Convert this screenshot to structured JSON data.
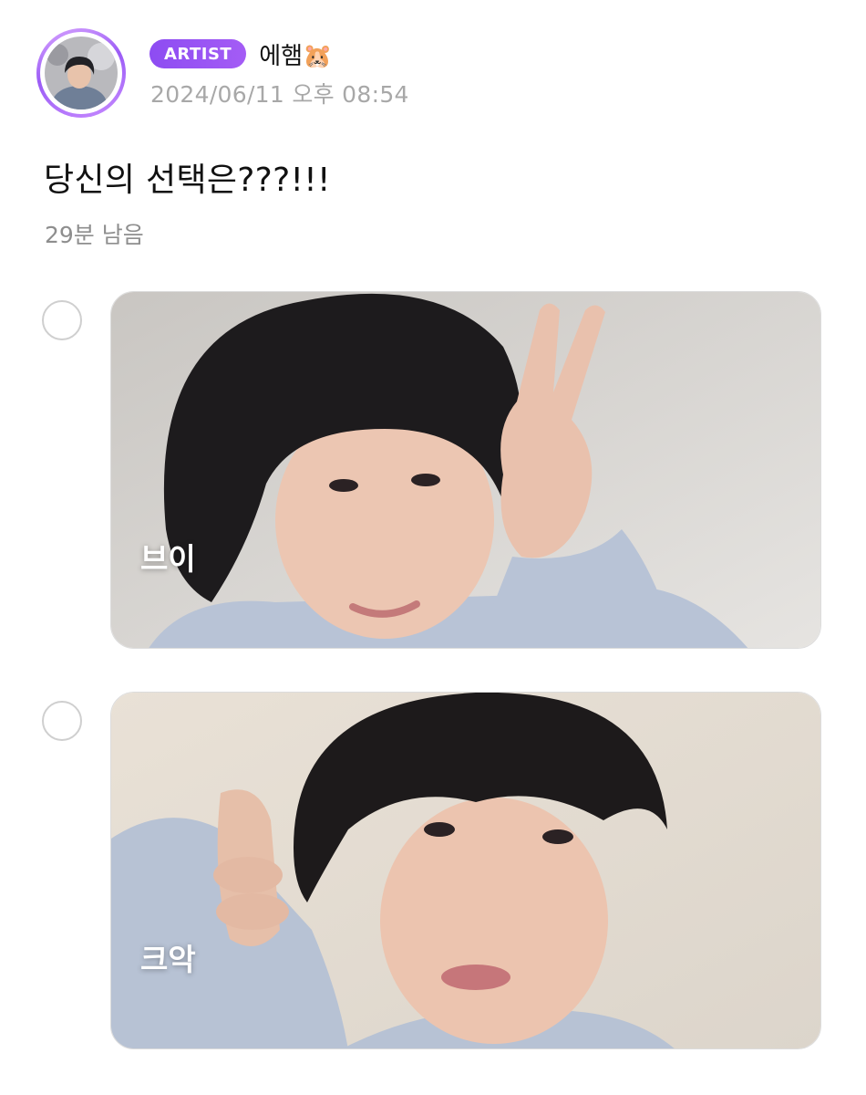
{
  "post": {
    "badge": "ARTIST",
    "author": "에햄🐹",
    "date": "2024/06/11 오후 08:54"
  },
  "poll": {
    "question": "당신의 선택은???!!!",
    "time_left": "29분 남음",
    "options": [
      {
        "label": "브이",
        "selected": false
      },
      {
        "label": "크악",
        "selected": false
      }
    ]
  },
  "colors": {
    "badge_purple": "#9550f4",
    "date_gray": "#a8a8a8",
    "radio_border": "#cfcfcf"
  }
}
